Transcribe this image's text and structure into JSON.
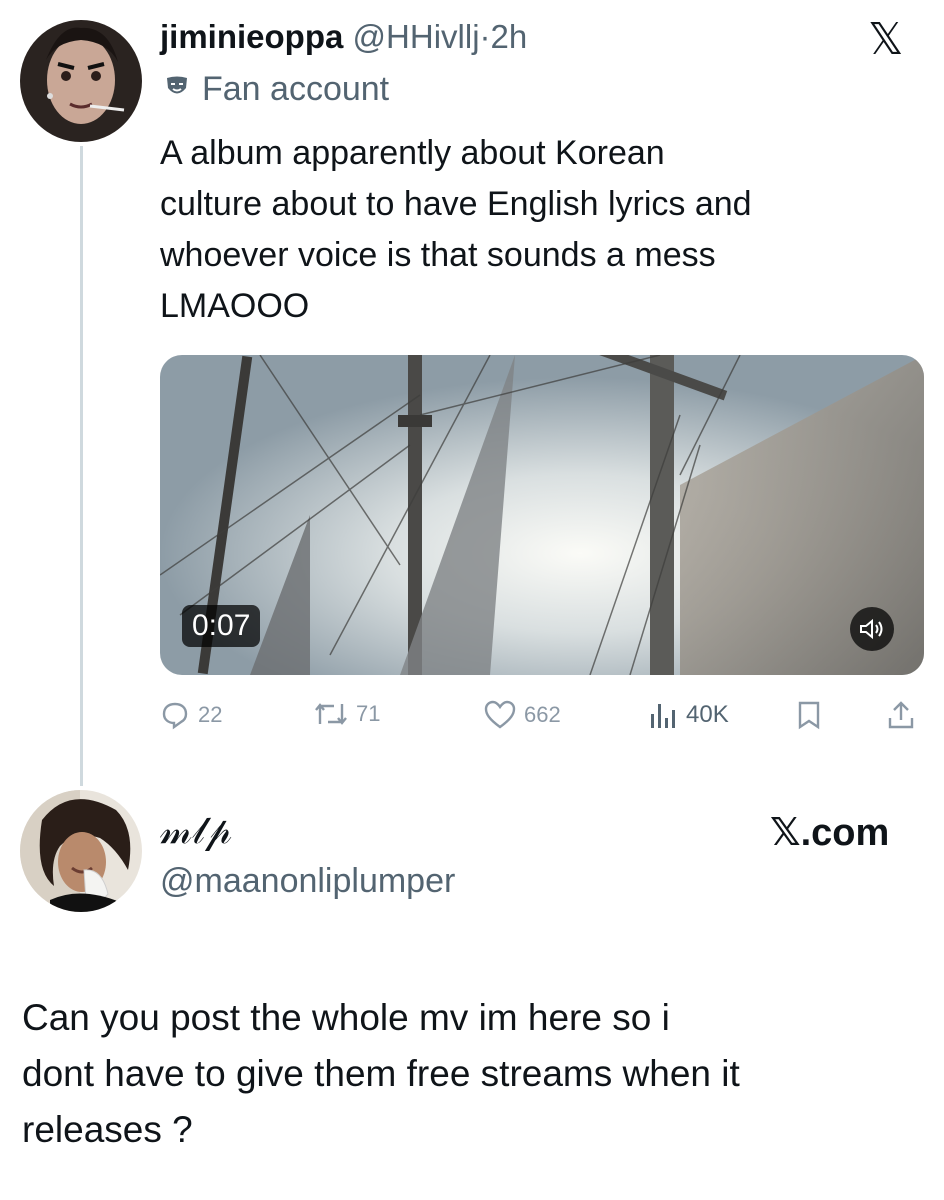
{
  "tweet": {
    "display_name": "jiminieoppa",
    "handle": "@HHivllj",
    "separator": "·",
    "time": "2h",
    "label": "Fan account",
    "text_lines": [
      "A album apparently about Korean",
      "culture about to have English lyrics and",
      "whoever voice is that sounds a mess",
      "LMAOOO"
    ],
    "video": {
      "duration": "0:07"
    },
    "stats": {
      "replies": "22",
      "reposts": "71",
      "likes": "662",
      "views": "40K"
    }
  },
  "reply": {
    "display_name": "𝓂𝓁𝓅",
    "handle": "@maanonliplumper",
    "source_label": "𝕏.com",
    "text_lines": [
      "Can you post the whole mv im here so i",
      "dont have to give them free streams when it",
      "releases ?"
    ]
  },
  "top_logo": "𝕏",
  "icons": {
    "label_icon": "theater-mask-icon",
    "volume": "speaker-icon",
    "reply": "comment-icon",
    "repost": "repost-icon",
    "like": "heart-icon",
    "views": "bar-chart-icon",
    "bookmark": "bookmark-icon",
    "share": "share-icon"
  },
  "colors": {
    "text": "#0f1419",
    "secondary": "#536471",
    "muted": "#8b98a5",
    "line": "#cfd9de"
  }
}
